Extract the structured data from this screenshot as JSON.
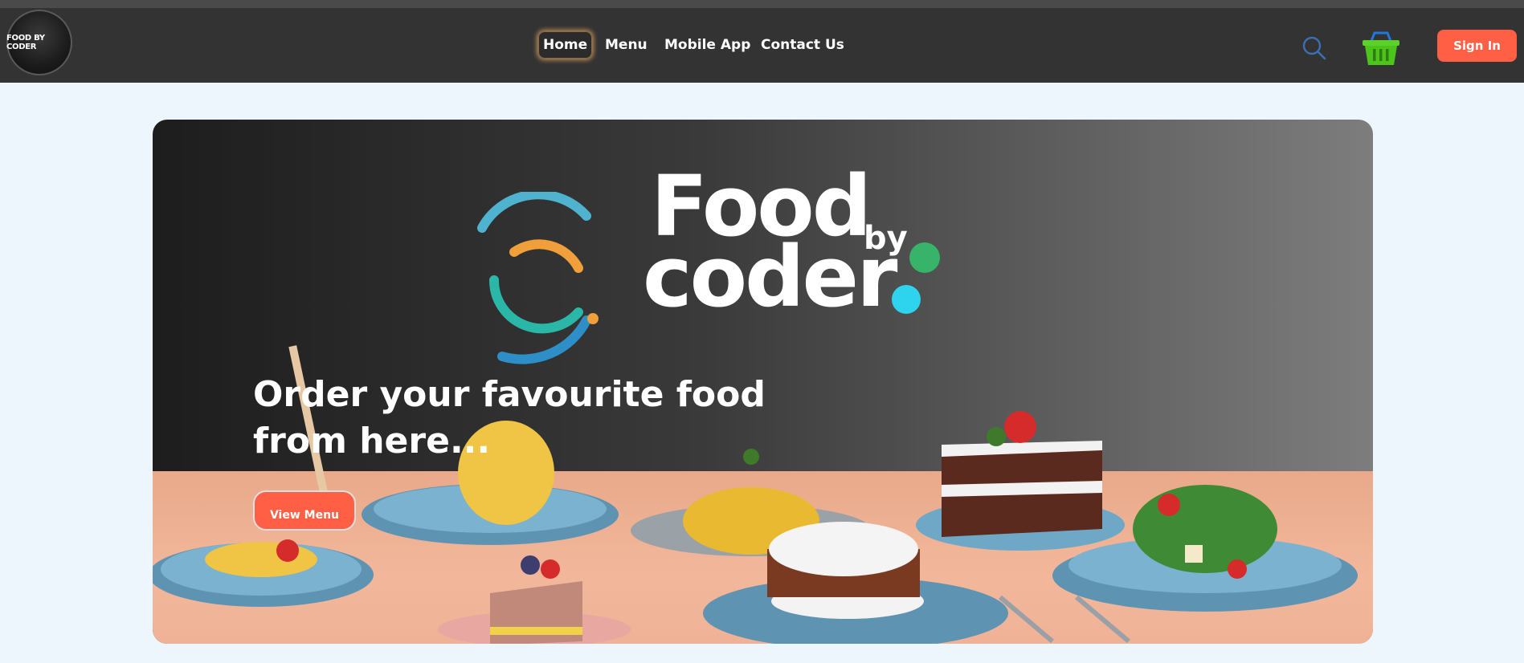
{
  "navbar": {
    "logo_text": "FOOD BY CODER",
    "links": [
      {
        "label": "Home",
        "active": true
      },
      {
        "label": "Menu",
        "active": false
      },
      {
        "label": "Mobile App",
        "active": false
      },
      {
        "label": "Contact Us",
        "active": false
      }
    ],
    "search_icon": "search-icon",
    "basket_icon": "basket-icon",
    "signin_label": "Sign In"
  },
  "hero": {
    "brand_food": "Food",
    "brand_by": "by",
    "brand_coder": "coder",
    "headline": "Order your favourite food from here...",
    "cta_label": "View Menu"
  },
  "colors": {
    "accent": "#ff5f45",
    "navbar": "#333333",
    "page_bg": "#eef6fd"
  }
}
